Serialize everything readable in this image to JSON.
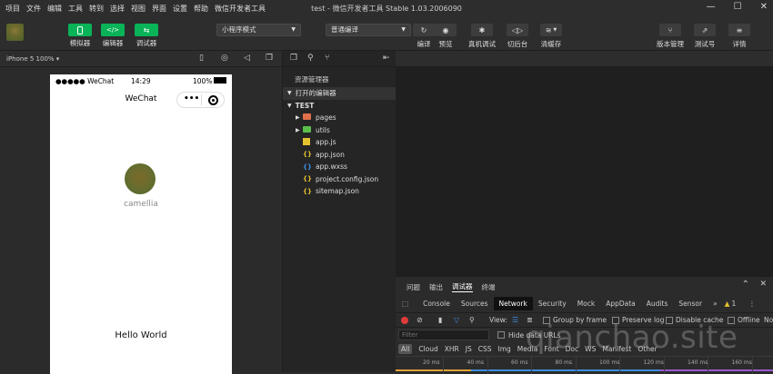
{
  "menu": {
    "items": [
      "项目",
      "文件",
      "编辑",
      "工具",
      "转到",
      "选择",
      "视图",
      "界面",
      "设置",
      "帮助",
      "微信开发者工具"
    ],
    "window_title": "test - 微信开发者工具 Stable 1.03.2006090",
    "window_buttons": [
      "—",
      "☐",
      "✕"
    ]
  },
  "toolbar": {
    "simulator_label": "模拟器",
    "editor_label": "编辑器",
    "debugger_label": "调试器",
    "mode_select": "小程序模式",
    "compile_select": "普通编译",
    "compile_label": "编译",
    "preview_label": "预览",
    "remote_debug_label": "真机调试",
    "background_label": "切后台",
    "clear_cache_label": "清缓存",
    "version_label": "版本管理",
    "test_label": "测试号",
    "details_label": "详情"
  },
  "simulator": {
    "device": "iPhone 5 100% ▾",
    "status_carrier": "●●●●● WeChat",
    "status_time": "14:29",
    "status_battery": "100%",
    "nav_title": "WeChat",
    "username": "camellia",
    "hello": "Hello World"
  },
  "explorer": {
    "title": "资源管理器",
    "open_editors": "打开的编辑器",
    "project": "TEST",
    "items": [
      {
        "name": "pages",
        "type": "folder",
        "color": "#e0704a"
      },
      {
        "name": "utils",
        "type": "folder",
        "color": "#5bbf4a"
      },
      {
        "name": "app.js",
        "type": "js",
        "color": "#e5c12e"
      },
      {
        "name": "app.json",
        "type": "json",
        "color": "#e5c12e"
      },
      {
        "name": "app.wxss",
        "type": "wxss",
        "color": "#3b8ee0"
      },
      {
        "name": "project.config.json",
        "type": "json",
        "color": "#e5c12e"
      },
      {
        "name": "sitemap.json",
        "type": "json",
        "color": "#e5c12e"
      }
    ]
  },
  "devtools": {
    "panel_tabs": [
      "问题",
      "输出",
      "调试器",
      "终端"
    ],
    "active_panel_tab": "调试器",
    "tabs": [
      "Console",
      "Sources",
      "Network",
      "Security",
      "Mock",
      "AppData",
      "Audits",
      "Sensor",
      "»"
    ],
    "active_tab": "Network",
    "warning_count": "1",
    "view_label": "View:",
    "group_by_frame": "Group by frame",
    "preserve_log": "Preserve log",
    "disable_cache": "Disable cache",
    "offline": "Offline",
    "no_throttle": "No",
    "filter_placeholder": "Filter",
    "hide_data_urls": "Hide data URLs",
    "filter_types": [
      "All",
      "Cloud",
      "XHR",
      "JS",
      "CSS",
      "Img",
      "Media",
      "Font",
      "Doc",
      "WS",
      "Manifest",
      "Other"
    ],
    "timeline_ticks": [
      "20 ms",
      "40 ms",
      "60 ms",
      "80 ms",
      "100 ms",
      "120 ms",
      "140 ms",
      "160 ms"
    ]
  },
  "watermark": "qianchao.site"
}
